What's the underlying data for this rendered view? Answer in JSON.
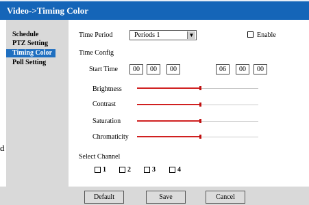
{
  "window": {
    "title": "Video->Timing Color"
  },
  "sidebar": {
    "items": [
      {
        "label": "Schedule",
        "active": false
      },
      {
        "label": "PTZ Setting",
        "active": false
      },
      {
        "label": "Timing Color",
        "active": true
      },
      {
        "label": "Poll Setting",
        "active": false
      }
    ]
  },
  "form": {
    "time_period_label": "Time Period",
    "time_period_value": "Periods 1",
    "enable_label": "Enable",
    "time_config_label": "Time Config",
    "start_time_label": "Start Time",
    "start_time": [
      "00",
      "00",
      "00"
    ],
    "end_time": [
      "06",
      "00",
      "00"
    ]
  },
  "sliders": [
    {
      "label": "Brightness",
      "value": 0.52
    },
    {
      "label": "Contrast",
      "value": 0.52
    },
    {
      "label": "Saturation",
      "value": 0.52
    },
    {
      "label": "Chromaticity",
      "value": 0.52
    }
  ],
  "channels": {
    "label": "Select Channel",
    "items": [
      "1",
      "2",
      "3",
      "4"
    ]
  },
  "buttons": {
    "default": "Default",
    "save": "Save",
    "cancel": "Cancel"
  },
  "edge_glyph": "d"
}
